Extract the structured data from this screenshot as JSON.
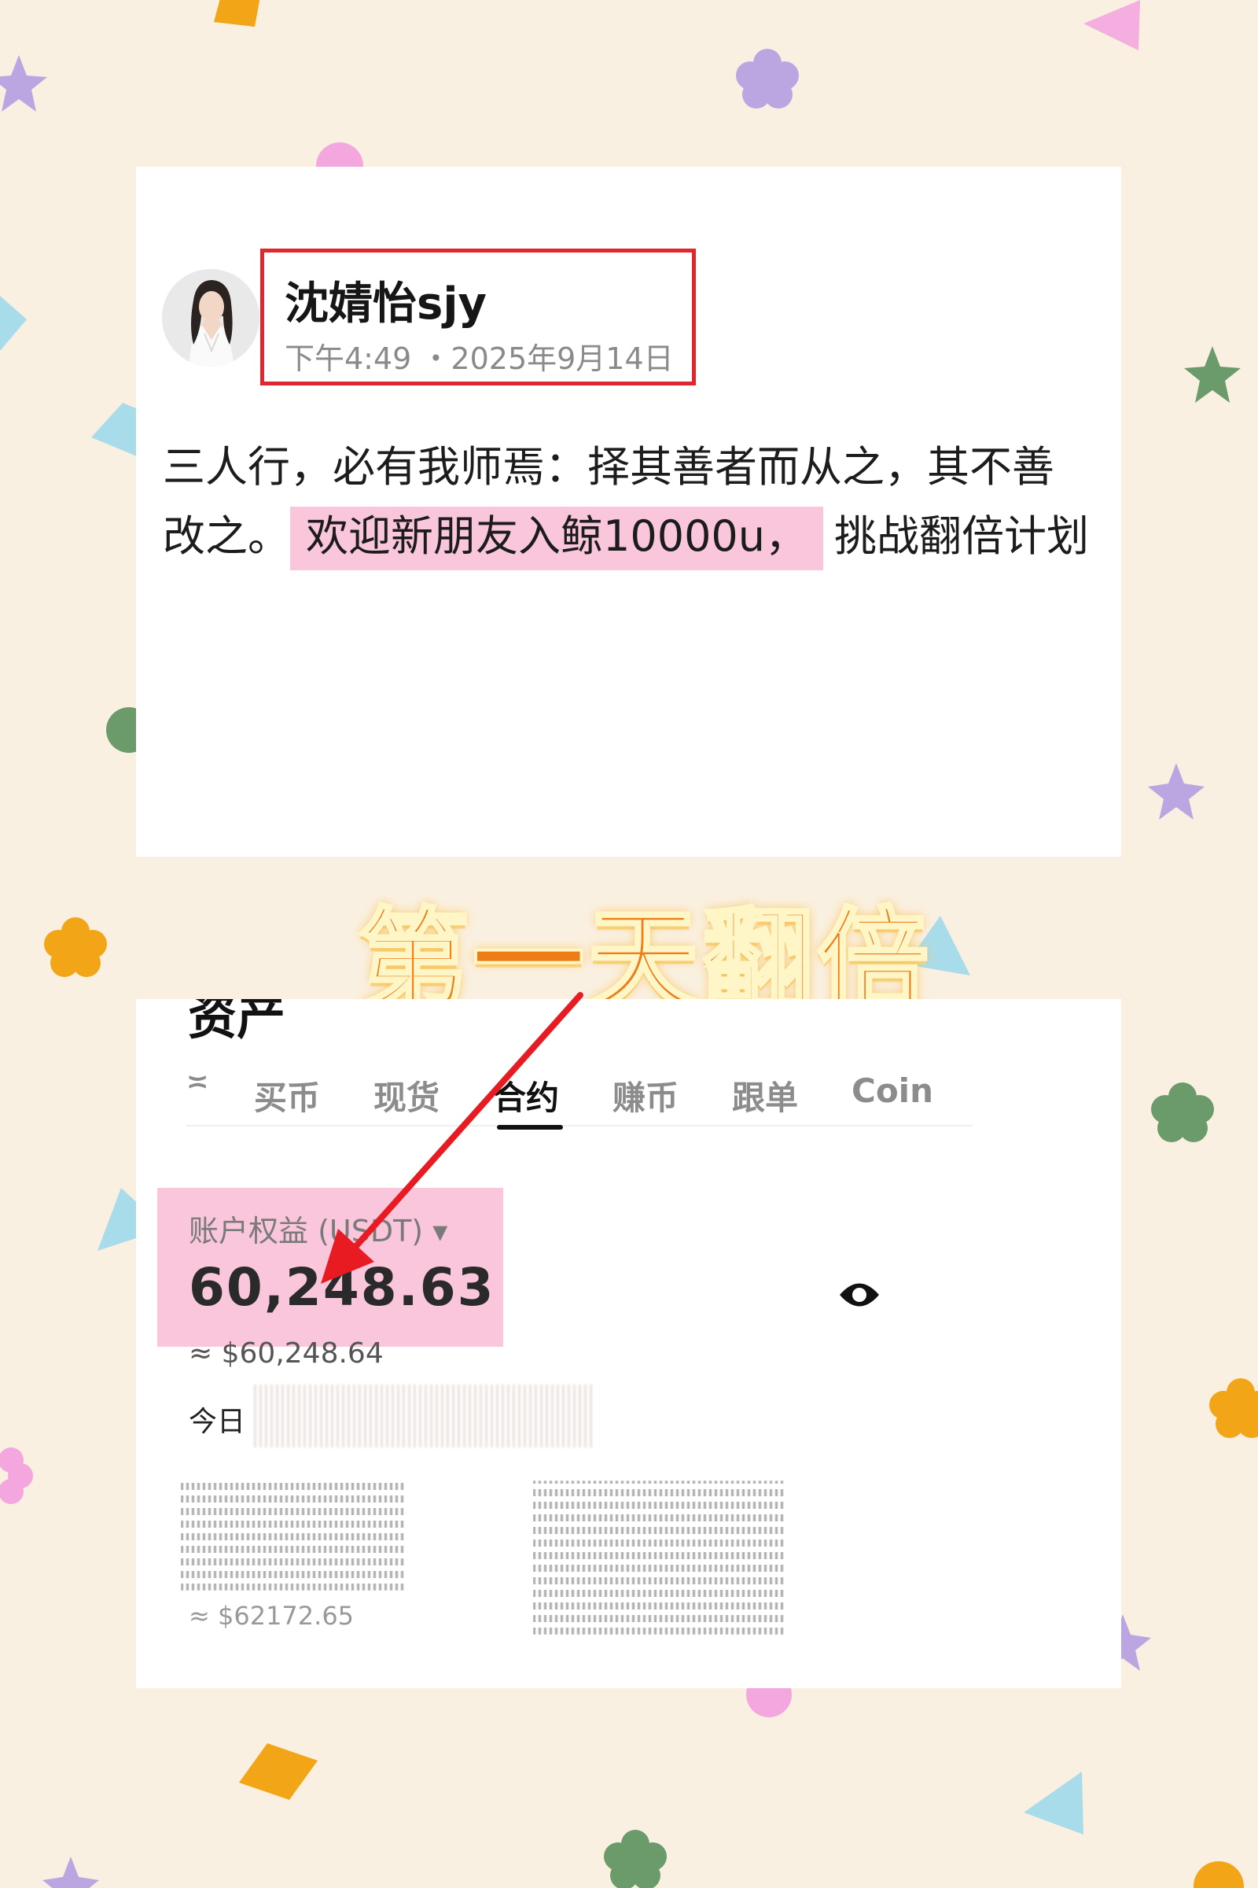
{
  "post": {
    "author_name": "沈婧怡sjy",
    "time": "下午4:49 ・2025年9月14日",
    "line1": "三人行，必有我师焉：择其善者而从之，其不善",
    "line2_start": "改之。",
    "line2_highlight": "欢迎新朋友入鲸10000u，",
    "line2_end": "挑战翻倍计划"
  },
  "headline": "第一天翻倍",
  "assets": {
    "title": "资产",
    "tabs": [
      "≍",
      "买币",
      "现货",
      "合约",
      "赚币",
      "跟单",
      "Coin"
    ],
    "active_tab": "合约",
    "equity_label": "账户权益 (USDT) ▾",
    "equity_value": "60,248.63",
    "equity_usd": "≈ $60,248.64",
    "today_label": "今日",
    "equity_usd_secondary": "≈ $62172.65"
  },
  "colors": {
    "background": "#faf0e1",
    "highlight_pink": "#f9c6dc",
    "name_box_red": "#e0272e",
    "headline_orange": "#ee7d18",
    "arrow_red": "#e81b23"
  },
  "icons": {
    "eye": "eye-icon",
    "arrow": "red-arrow"
  }
}
